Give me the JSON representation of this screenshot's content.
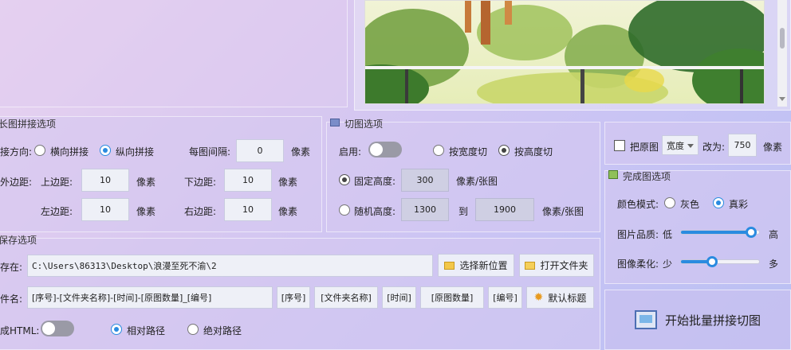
{
  "stitch": {
    "title": "长图拼接选项",
    "direction_label": "接方向:",
    "horizontal": "横向拼接",
    "vertical": "纵向拼接",
    "spacing_label": "每图间隔:",
    "spacing_value": "0",
    "px": "像素",
    "outer_margin_label": "外边距:",
    "top_label": "上边距:",
    "top_value": "10",
    "bottom_label": "下边距:",
    "bottom_value": "10",
    "left_label": "左边距:",
    "left_value": "10",
    "right_label": "右边距:",
    "right_value": "10"
  },
  "cut": {
    "title": "切图选项",
    "enable_label": "启用:",
    "by_width": "按宽度切",
    "by_height": "按高度切",
    "fixed_height_label": "固定高度:",
    "fixed_height_value": "300",
    "per_image_unit": "像素/张图",
    "random_height_label": "随机高度:",
    "random_from": "1300",
    "to": "到",
    "random_to": "1900",
    "random_unit": "像素/张图"
  },
  "resize": {
    "checkbox_label": "把原图",
    "dimension_select": "宽度",
    "change_to": "改为:",
    "value": "750",
    "unit": "像素"
  },
  "finish": {
    "title": "完成图选项",
    "color_mode_label": "颜色模式:",
    "gray": "灰色",
    "true_color": "真彩",
    "quality_label": "图片品质:",
    "quality_low": "低",
    "quality_high": "高",
    "quality_level": 0.9,
    "softness_label": "图像柔化:",
    "softness_low": "少",
    "softness_high": "多",
    "softness_level": 0.4
  },
  "save": {
    "title": "保存选项",
    "save_to_label": "存在:",
    "path": "C:\\Users\\86313\\Desktop\\浪漫至死不渝\\2",
    "choose_location": "选择新位置",
    "open_folder": "打开文件夹",
    "filename_label": "件名:",
    "filename_pattern": "[序号]-[文件夹名称]-[时间]-[原图数量]_[编号]",
    "tag_seq": "[序号]",
    "tag_folder": "[文件夹名称]",
    "tag_time": "[时间]",
    "tag_count": "[原图数量]",
    "tag_num": "[编号]",
    "default_title": "默认标题",
    "html_label": "成HTML:",
    "relative_path": "相对路径",
    "absolute_path": "绝对路径"
  },
  "start_button": "开始批量拼接切图",
  "colors": {
    "accent": "#2a8be0",
    "panel_bg": "#d6c8f0"
  }
}
